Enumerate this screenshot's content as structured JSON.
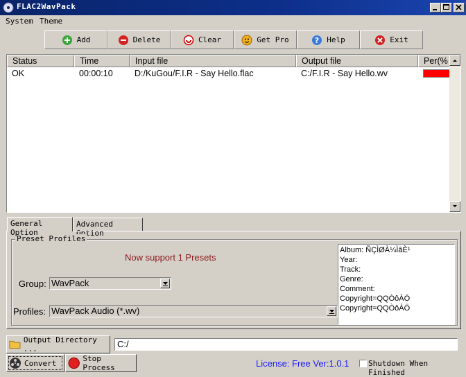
{
  "window": {
    "title": "FLAC2WavPack"
  },
  "menu": {
    "items": [
      {
        "label": "System",
        "accel": "S"
      },
      {
        "label": "Theme",
        "accel": "T"
      }
    ]
  },
  "toolbar": {
    "buttons": [
      {
        "label": "Add",
        "icon": "add-icon"
      },
      {
        "label": "Delete",
        "icon": "delete-icon"
      },
      {
        "label": "Clear",
        "icon": "clear-icon"
      },
      {
        "label": "Get Pro",
        "icon": "getpro-icon"
      },
      {
        "label": "Help",
        "icon": "help-icon"
      },
      {
        "label": "Exit",
        "icon": "exit-icon"
      }
    ]
  },
  "list": {
    "columns": [
      "Status",
      "Time",
      "Input file",
      "Output file",
      "Per(%"
    ],
    "rows": [
      {
        "status": "OK",
        "time": "00:00:10",
        "input": "D:/KuGou/F.I.R - Say Hello.flac",
        "output": "C:/F.I.R - Say Hello.wv",
        "progress": 100
      }
    ]
  },
  "tabs": {
    "items": [
      "General Option",
      "Advanced Option"
    ],
    "active": 0
  },
  "presets": {
    "group_title": "Preset Profiles",
    "support_text": "Now support 1 Presets",
    "group_label": "Group:",
    "group_value": "WavPack",
    "profiles_label": "Profiles:",
    "profiles_value": "WavPack Audio (*.wv)"
  },
  "info": {
    "lines": [
      "Album:   ÑÇÌØÀ¼ÌâÈ¹",
      "Year:",
      "Track:",
      "Genre:",
      "Comment:",
      "Copyright=QQÒôÀÖ",
      "Copyright=QQÒôÀÖ"
    ]
  },
  "bottom": {
    "output_dir_label": "Output Directory ...",
    "output_dir_value": "C:/",
    "convert_label": "Convert",
    "stop_label": "Stop Process",
    "license_text": "License: Free Ver:1.0.1",
    "shutdown_label": "Shutdown When Finished",
    "shutdown_checked": false
  },
  "colors": {
    "titlebar": "#0a246a",
    "progress_fill": "#ff0000",
    "support_text": "#8b1a1a",
    "license_text": "#1a1aff"
  }
}
